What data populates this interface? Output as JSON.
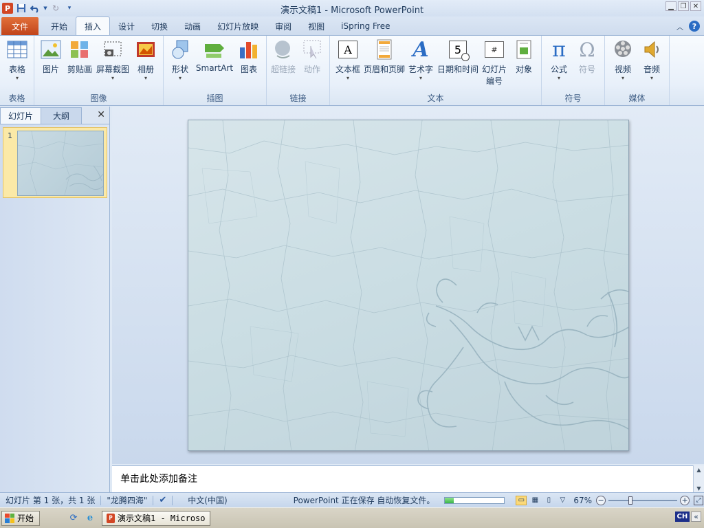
{
  "titlebar": {
    "title": "演示文稿1 - Microsoft PowerPoint",
    "app_icon": "P"
  },
  "tabs": [
    {
      "label": "文件"
    },
    {
      "label": "开始"
    },
    {
      "label": "插入"
    },
    {
      "label": "设计"
    },
    {
      "label": "切换"
    },
    {
      "label": "动画"
    },
    {
      "label": "幻灯片放映"
    },
    {
      "label": "审阅"
    },
    {
      "label": "视图"
    },
    {
      "label": "iSpring Free"
    }
  ],
  "ribbon": {
    "groups": {
      "table": "表格",
      "images": "图像",
      "illustrations": "插图",
      "links": "链接",
      "text": "文本",
      "symbols": "符号",
      "media": "媒体"
    },
    "buttons": {
      "table": "表格",
      "picture": "图片",
      "clipart": "剪贴画",
      "screenshot": "屏幕截图",
      "album": "相册",
      "shapes": "形状",
      "smartart": "SmartArt",
      "chart": "图表",
      "hyperlink": "超链接",
      "action": "动作",
      "textbox": "文本框",
      "header_footer": "页眉和页脚",
      "wordart": "艺术字",
      "datetime": "日期和时间",
      "slide_number": "幻灯片",
      "slide_number_2": "编号",
      "object": "对象",
      "equation": "公式",
      "symbol": "符号",
      "video": "视频",
      "audio": "音频"
    },
    "icons": {
      "equation": "π",
      "symbol": "Ω",
      "textbox": "A",
      "wordart": "A",
      "datetime": "5",
      "slide_number": "#"
    }
  },
  "leftpane": {
    "tab_slides": "幻灯片",
    "tab_outline": "大纲",
    "thumb_number": "1"
  },
  "notes": {
    "placeholder": "单击此处添加备注"
  },
  "status": {
    "slide_info": "幻灯片 第 1 张，共 1 张",
    "theme": "\"龙腾四海\"",
    "language": "中文(中国)",
    "saving": "PowerPoint 正在保存 自动恢复文件。",
    "progress": 0.15,
    "zoom": "67%"
  },
  "taskbar": {
    "start": "开始",
    "item": "演示文稿1 - Microso...",
    "ime": "CH",
    "tray_arrow": "«"
  },
  "colors": {
    "file_tab": "#c1441b",
    "accent": "#2a6cc4",
    "slide_bg": "#cadde3"
  }
}
